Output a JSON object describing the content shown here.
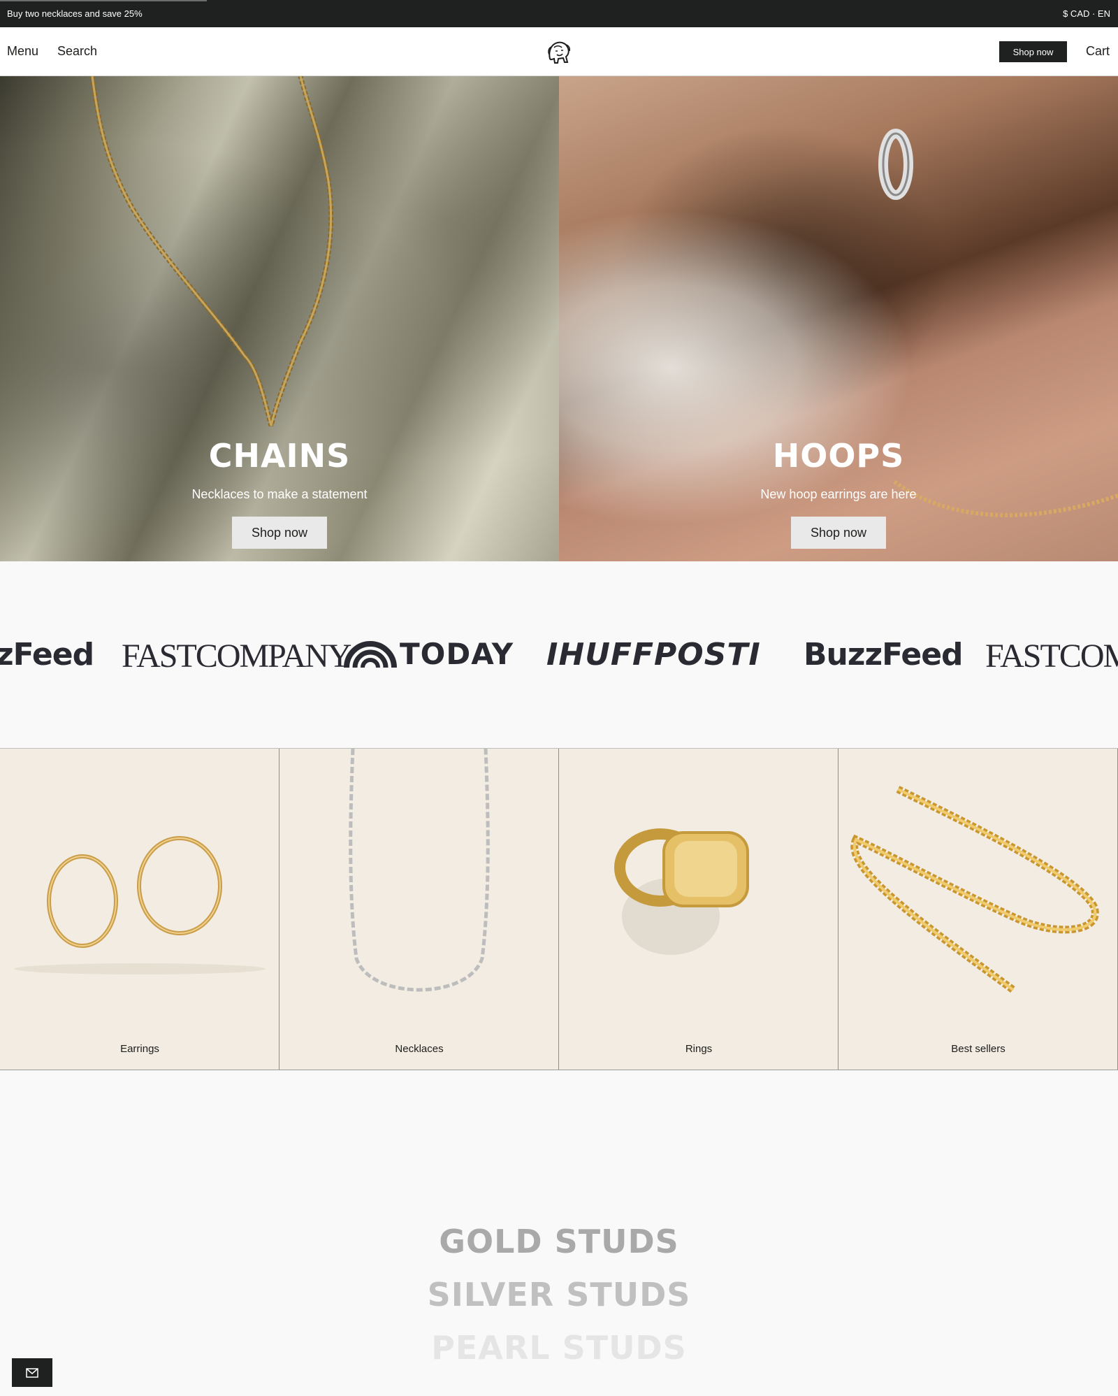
{
  "announcement": {
    "message": "Buy two necklaces and save 25%",
    "locale": "$ CAD · EN"
  },
  "header": {
    "menu": "Menu",
    "search": "Search",
    "shop_now": "Shop now",
    "cart": "Cart",
    "logo_icon": "lion-logo-icon"
  },
  "hero": [
    {
      "title": "CHAINS",
      "subtitle": "Necklaces to make a statement",
      "cta": "Shop now"
    },
    {
      "title": "HOOPS",
      "subtitle": "New hoop earrings are here",
      "cta": "Shop now"
    }
  ],
  "press": [
    "zFeed",
    "FASTCOMPANY",
    "TODAY",
    "IHUFFPOSTI",
    "BuzzFeed",
    "FASTCOMPA"
  ],
  "categories": [
    {
      "label": "Earrings"
    },
    {
      "label": "Necklaces"
    },
    {
      "label": "Rings"
    },
    {
      "label": "Best sellers"
    }
  ],
  "studs": [
    "GOLD STUDS",
    "SILVER STUDS",
    "PEARL STUDS"
  ],
  "footer": {
    "mail_icon": "mail-icon"
  },
  "colors": {
    "dark": "#1e211f",
    "category_bg": "#f2ece2",
    "page_bg": "#f9f9f9"
  }
}
